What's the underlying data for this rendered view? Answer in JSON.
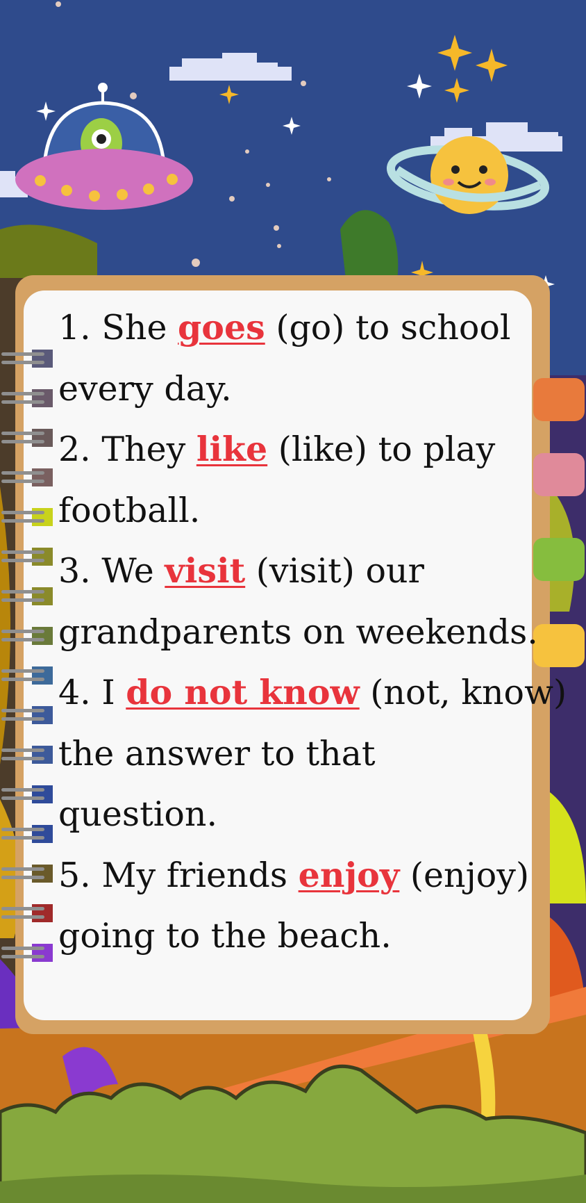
{
  "colors": {
    "sky": "#2f4b8c",
    "notebook_frame": "#d5a264",
    "paper": "#f8f8f8",
    "answer": "#e8343c",
    "tabs": [
      "#e87a3c",
      "#e08a9a",
      "#86bd3e",
      "#f6c23e"
    ]
  },
  "decorations": [
    "ufo-with-alien",
    "smiling-ringed-planet",
    "pixel-clouds",
    "stars",
    "jungle-leaves",
    "green-bushes"
  ],
  "sentences": [
    {
      "number": "1.",
      "lines": [
        {
          "before": "She ",
          "answer": "goes",
          "after": " (go) to school"
        },
        {
          "text": "every day."
        }
      ]
    },
    {
      "number": "2.",
      "lines": [
        {
          "before": "They ",
          "answer": "like",
          "after": " (like) to play"
        },
        {
          "text": "football."
        }
      ]
    },
    {
      "number": "3.",
      "lines": [
        {
          "before": "We ",
          "answer": "visit",
          "after": " (visit) our"
        },
        {
          "text": "grandparents on weekends."
        }
      ]
    },
    {
      "number": "4.",
      "lines": [
        {
          "before": "I ",
          "answer": "do not know",
          "after": " (not, know)"
        },
        {
          "text": "the answer to that"
        },
        {
          "text": "question."
        }
      ]
    },
    {
      "number": "5.",
      "lines": [
        {
          "before": "My friends ",
          "answer": "enjoy",
          "after": " (enjoy)"
        },
        {
          "text": "going to the beach."
        }
      ]
    }
  ]
}
